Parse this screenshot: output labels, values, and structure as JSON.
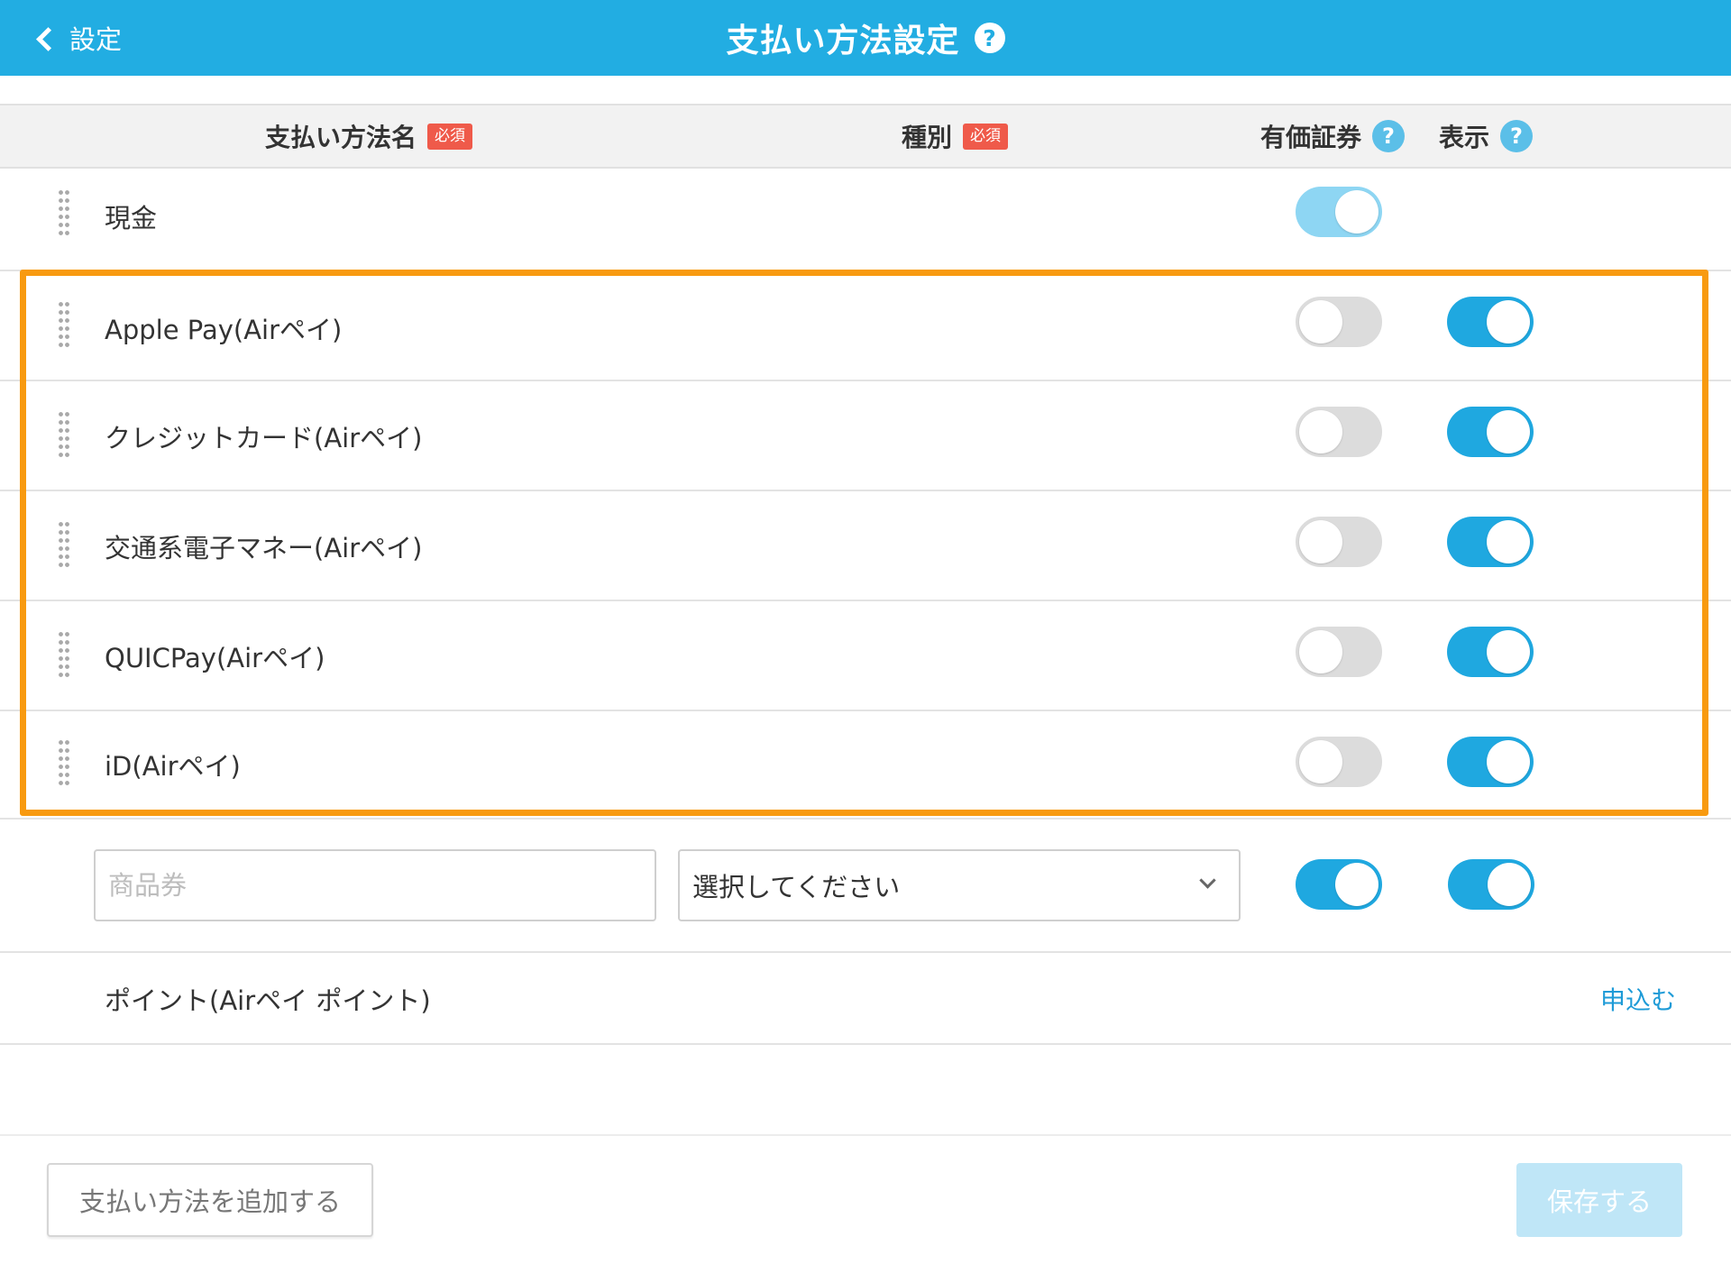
{
  "header": {
    "back_label": "設定",
    "title": "支払い方法設定",
    "help": "?"
  },
  "columns": {
    "name": "支払い方法名",
    "name_badge": "必須",
    "type": "種別",
    "type_badge": "必須",
    "voucher": "有価証券",
    "display": "表示",
    "help": "?"
  },
  "rows": [
    {
      "label": "現金",
      "voucher": "on-disabled",
      "display": null
    },
    {
      "label": "Apple Pay(Airペイ)",
      "voucher": "off",
      "display": "on"
    },
    {
      "label": "クレジットカード(Airペイ)",
      "voucher": "off",
      "display": "on"
    },
    {
      "label": "交通系電子マネー(Airペイ)",
      "voucher": "off",
      "display": "on"
    },
    {
      "label": "QUICPay(Airペイ)",
      "voucher": "off",
      "display": "on"
    },
    {
      "label": "iD(Airペイ)",
      "voucher": "off",
      "display": "on"
    }
  ],
  "new_row": {
    "name_placeholder": "商品券",
    "type_value": "選択してください",
    "voucher": "on",
    "display": "on"
  },
  "points_row": {
    "label": "ポイント(Airペイ ポイント)",
    "link": "申込む"
  },
  "footer": {
    "add_label": "支払い方法を追加する",
    "save_label": "保存する"
  },
  "colors": {
    "header_bg": "#22ade2",
    "toggle_on": "#1fa8e0",
    "highlight": "#f89a10",
    "required_badge": "#ef5a4a"
  }
}
